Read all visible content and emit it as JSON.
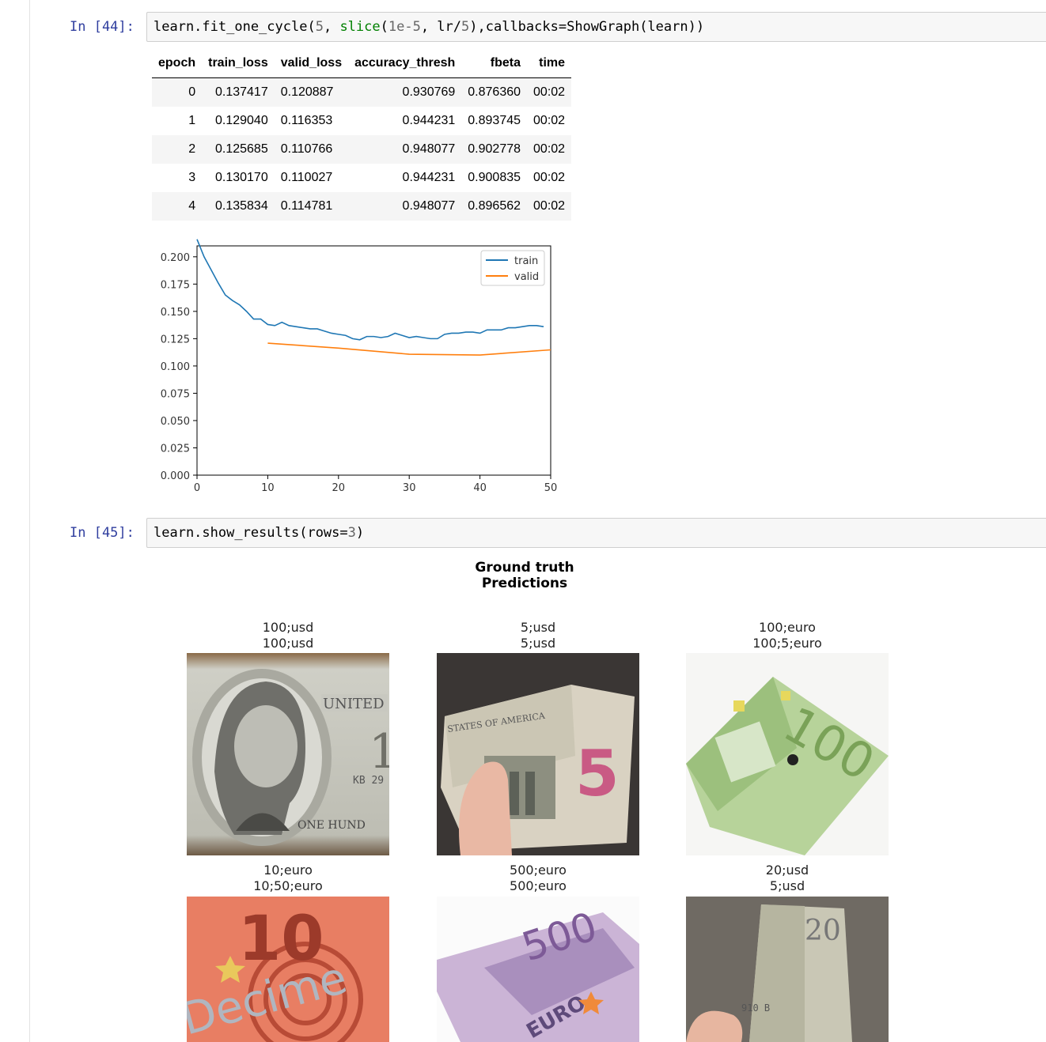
{
  "cells": [
    {
      "prompt": "In [44]:",
      "code_parts": {
        "p1": "learn.fit_one_cycle(",
        "n1": "5",
        "p2": ", ",
        "kw": "slice",
        "p3": "(",
        "n2": "1e-5",
        "p4": ", lr/",
        "n3": "5",
        "p5": "),callbacks=ShowGraph(learn))"
      }
    },
    {
      "prompt": "In [45]:",
      "code_parts": {
        "p1": "learn.show_results(rows=",
        "n1": "3",
        "p2": ")"
      }
    }
  ],
  "table": {
    "headers": [
      "epoch",
      "train_loss",
      "valid_loss",
      "accuracy_thresh",
      "fbeta",
      "time"
    ],
    "rows": [
      [
        "0",
        "0.137417",
        "0.120887",
        "0.930769",
        "0.876360",
        "00:02"
      ],
      [
        "1",
        "0.129040",
        "0.116353",
        "0.944231",
        "0.893745",
        "00:02"
      ],
      [
        "2",
        "0.125685",
        "0.110766",
        "0.948077",
        "0.902778",
        "00:02"
      ],
      [
        "3",
        "0.130170",
        "0.110027",
        "0.944231",
        "0.900835",
        "00:02"
      ],
      [
        "4",
        "0.135834",
        "0.114781",
        "0.948077",
        "0.896562",
        "00:02"
      ]
    ]
  },
  "chart_data": {
    "type": "line",
    "title": "",
    "xlabel": "",
    "ylabel": "",
    "xlim": [
      0,
      50
    ],
    "ylim": [
      0,
      0.21
    ],
    "xticks": [
      "0",
      "10",
      "20",
      "30",
      "40",
      "50"
    ],
    "yticks": [
      "0.000",
      "0.025",
      "0.050",
      "0.075",
      "0.100",
      "0.125",
      "0.150",
      "0.175",
      "0.200"
    ],
    "legend_position": "top-right",
    "series": [
      {
        "name": "train",
        "color": "#1f77b4",
        "x": [
          0,
          1,
          2,
          3,
          4,
          5,
          6,
          7,
          8,
          9,
          10,
          11,
          12,
          13,
          14,
          15,
          16,
          17,
          18,
          19,
          20,
          21,
          22,
          23,
          24,
          25,
          26,
          27,
          28,
          29,
          30,
          31,
          32,
          33,
          34,
          35,
          36,
          37,
          38,
          39,
          40,
          41,
          42,
          43,
          44,
          45,
          46,
          47,
          48,
          49
        ],
        "y": [
          0.216,
          0.2,
          0.188,
          0.176,
          0.165,
          0.16,
          0.156,
          0.15,
          0.143,
          0.143,
          0.138,
          0.137,
          0.14,
          0.137,
          0.136,
          0.135,
          0.134,
          0.134,
          0.132,
          0.13,
          0.129,
          0.128,
          0.125,
          0.124,
          0.127,
          0.127,
          0.126,
          0.127,
          0.13,
          0.128,
          0.126,
          0.127,
          0.126,
          0.125,
          0.125,
          0.129,
          0.13,
          0.13,
          0.131,
          0.131,
          0.13,
          0.133,
          0.133,
          0.133,
          0.135,
          0.135,
          0.136,
          0.137,
          0.137,
          0.136
        ]
      },
      {
        "name": "valid",
        "color": "#ff7f0e",
        "x": [
          10,
          20,
          30,
          40,
          50
        ],
        "y": [
          0.120887,
          0.116353,
          0.110766,
          0.110027,
          0.114781
        ]
      }
    ]
  },
  "show_results": {
    "title_line1": "Ground truth",
    "title_line2": "Predictions",
    "items": [
      {
        "truth": "100;usd",
        "pred": "100;usd",
        "image": "usd-100-bill"
      },
      {
        "truth": "5;usd",
        "pred": "5;usd",
        "image": "usd-5-bill"
      },
      {
        "truth": "100;euro",
        "pred": "100;5;euro",
        "image": "euro-100-bill"
      },
      {
        "truth": "10;euro",
        "pred": "10;50;euro",
        "image": "euro-10-bill"
      },
      {
        "truth": "500;euro",
        "pred": "500;euro",
        "image": "euro-500-bill"
      },
      {
        "truth": "20;usd",
        "pred": "5;usd",
        "image": "usd-20-bill"
      }
    ],
    "image_texts": {
      "usd100_united": "UNITED",
      "usd100_serial": "KB 29",
      "usd100_one_hund": "ONE HUND",
      "usd5_digit": "5",
      "usd5_america": "STATES OF AMERICA",
      "eur100_digit": "100",
      "eur10_digit": "10",
      "eur10_word": "Decime",
      "eur500_digit": "500",
      "eur500_euro": "EURO",
      "usd20_digit": "20",
      "usd20_serial": "910 B"
    }
  },
  "colors": {
    "prompt": "#303f9f",
    "keyword": "#008000",
    "train": "#1f77b4",
    "valid": "#ff7f0e"
  }
}
